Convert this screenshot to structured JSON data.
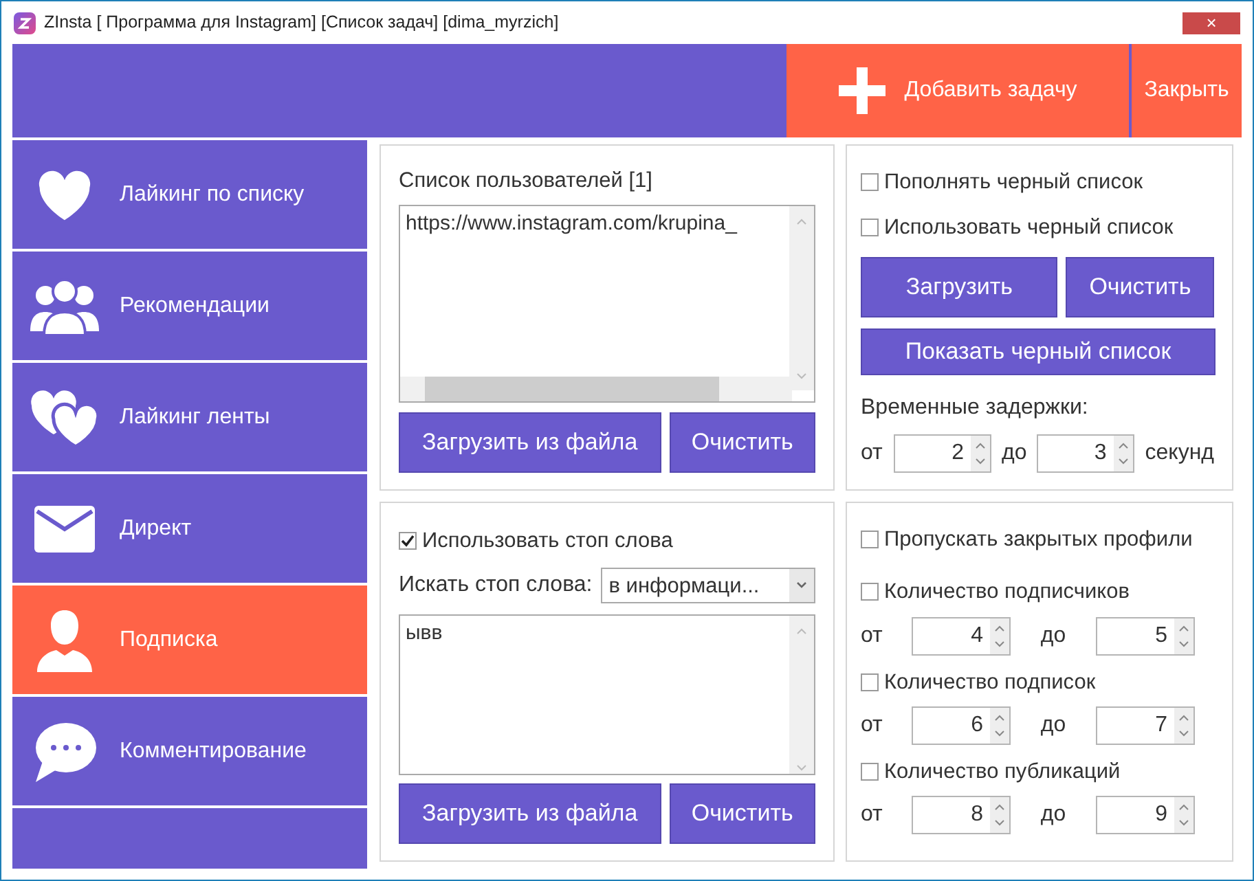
{
  "window": {
    "title": "ZInsta [ Программа для Instagram] [Список задач] [dima_myrzich]",
    "close": "×"
  },
  "toolbar": {
    "buttons": [
      {
        "label": "Добавить задачу",
        "kind": "add"
      },
      {
        "label": "Закрыть",
        "kind": "plain"
      }
    ]
  },
  "sidebar": {
    "items": [
      {
        "label": "Лайкинг по списку",
        "selected": false
      },
      {
        "label": "Рекомендации",
        "selected": false
      },
      {
        "label": "Лайкинг ленты",
        "selected": false
      },
      {
        "label": "Директ",
        "selected": false
      },
      {
        "label": "Подписка",
        "selected": true
      },
      {
        "label": "Комментирование",
        "selected": false
      }
    ]
  },
  "users_panel": {
    "title": "Список пользователей [1]",
    "text": "https://www.instagram.com/krupina_",
    "buttons": [
      "Загрузить из файла",
      "Очистить"
    ]
  },
  "blacklist_panel": {
    "checkboxes": [
      {
        "label": "Пополнять черный список",
        "checked": false
      },
      {
        "label": "Использовать черный список",
        "checked": false
      }
    ],
    "buttons": [
      "Загрузить",
      "Очистить"
    ],
    "show_button": "Показать черный список",
    "delays_label": "Временные задержки:",
    "delay": {
      "from_label": "от",
      "from": "2",
      "to_label": "до",
      "to": "3",
      "unit": "секунд"
    }
  },
  "stopwords_panel": {
    "checkbox": {
      "label": "Использовать стоп слова",
      "checked": true
    },
    "search_label": "Искать стоп слова:",
    "search_select": "в информаци...",
    "text": "ывв",
    "buttons": [
      "Загрузить из файла",
      "Очистить"
    ]
  },
  "filters_panel": {
    "skip_private": {
      "label": "Пропускать закрытых профили",
      "checked": false
    },
    "ranges": [
      {
        "label": "Количество подписчиков",
        "checked": false,
        "from_label": "от",
        "from": "4",
        "to_label": "до",
        "to": "5"
      },
      {
        "label": "Количество подписок",
        "checked": false,
        "from_label": "от",
        "from": "6",
        "to_label": "до",
        "to": "7"
      },
      {
        "label": "Количество публикаций",
        "checked": false,
        "from_label": "от",
        "from": "8",
        "to_label": "до",
        "to": "9"
      }
    ]
  }
}
